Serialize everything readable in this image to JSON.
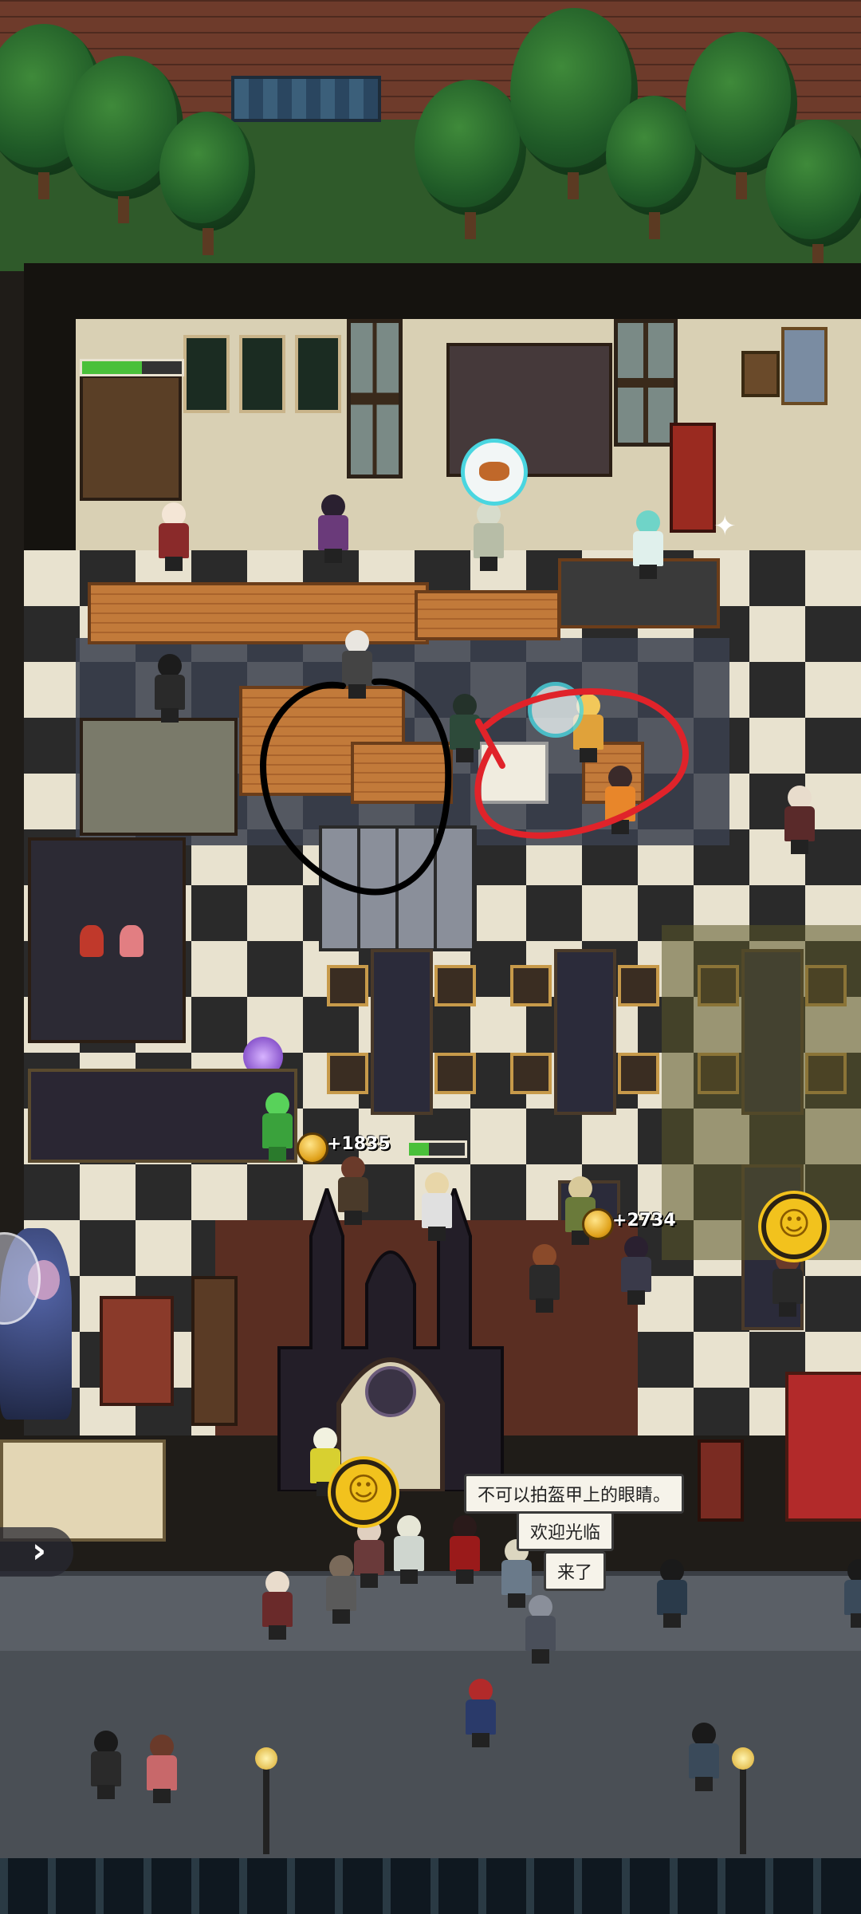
{
  "hud": {
    "coin_left": "+1835",
    "coin_right": "+2734",
    "progress_top": 0.6,
    "progress_mid": 0.35,
    "side_arrow": "›"
  },
  "speech": {
    "line1": "不可以拍盔甲上的眼睛。",
    "line2": "欢迎光临",
    "line3": "来了"
  },
  "icons": {
    "smile_face": "☺",
    "sparkle": "✦"
  },
  "colors": {
    "black_annotation": "#000000",
    "red_annotation": "#e0232a",
    "floor_dark": "#2b2b2b",
    "floor_light": "#e8e2cf",
    "grass": "#2f6a2e"
  }
}
